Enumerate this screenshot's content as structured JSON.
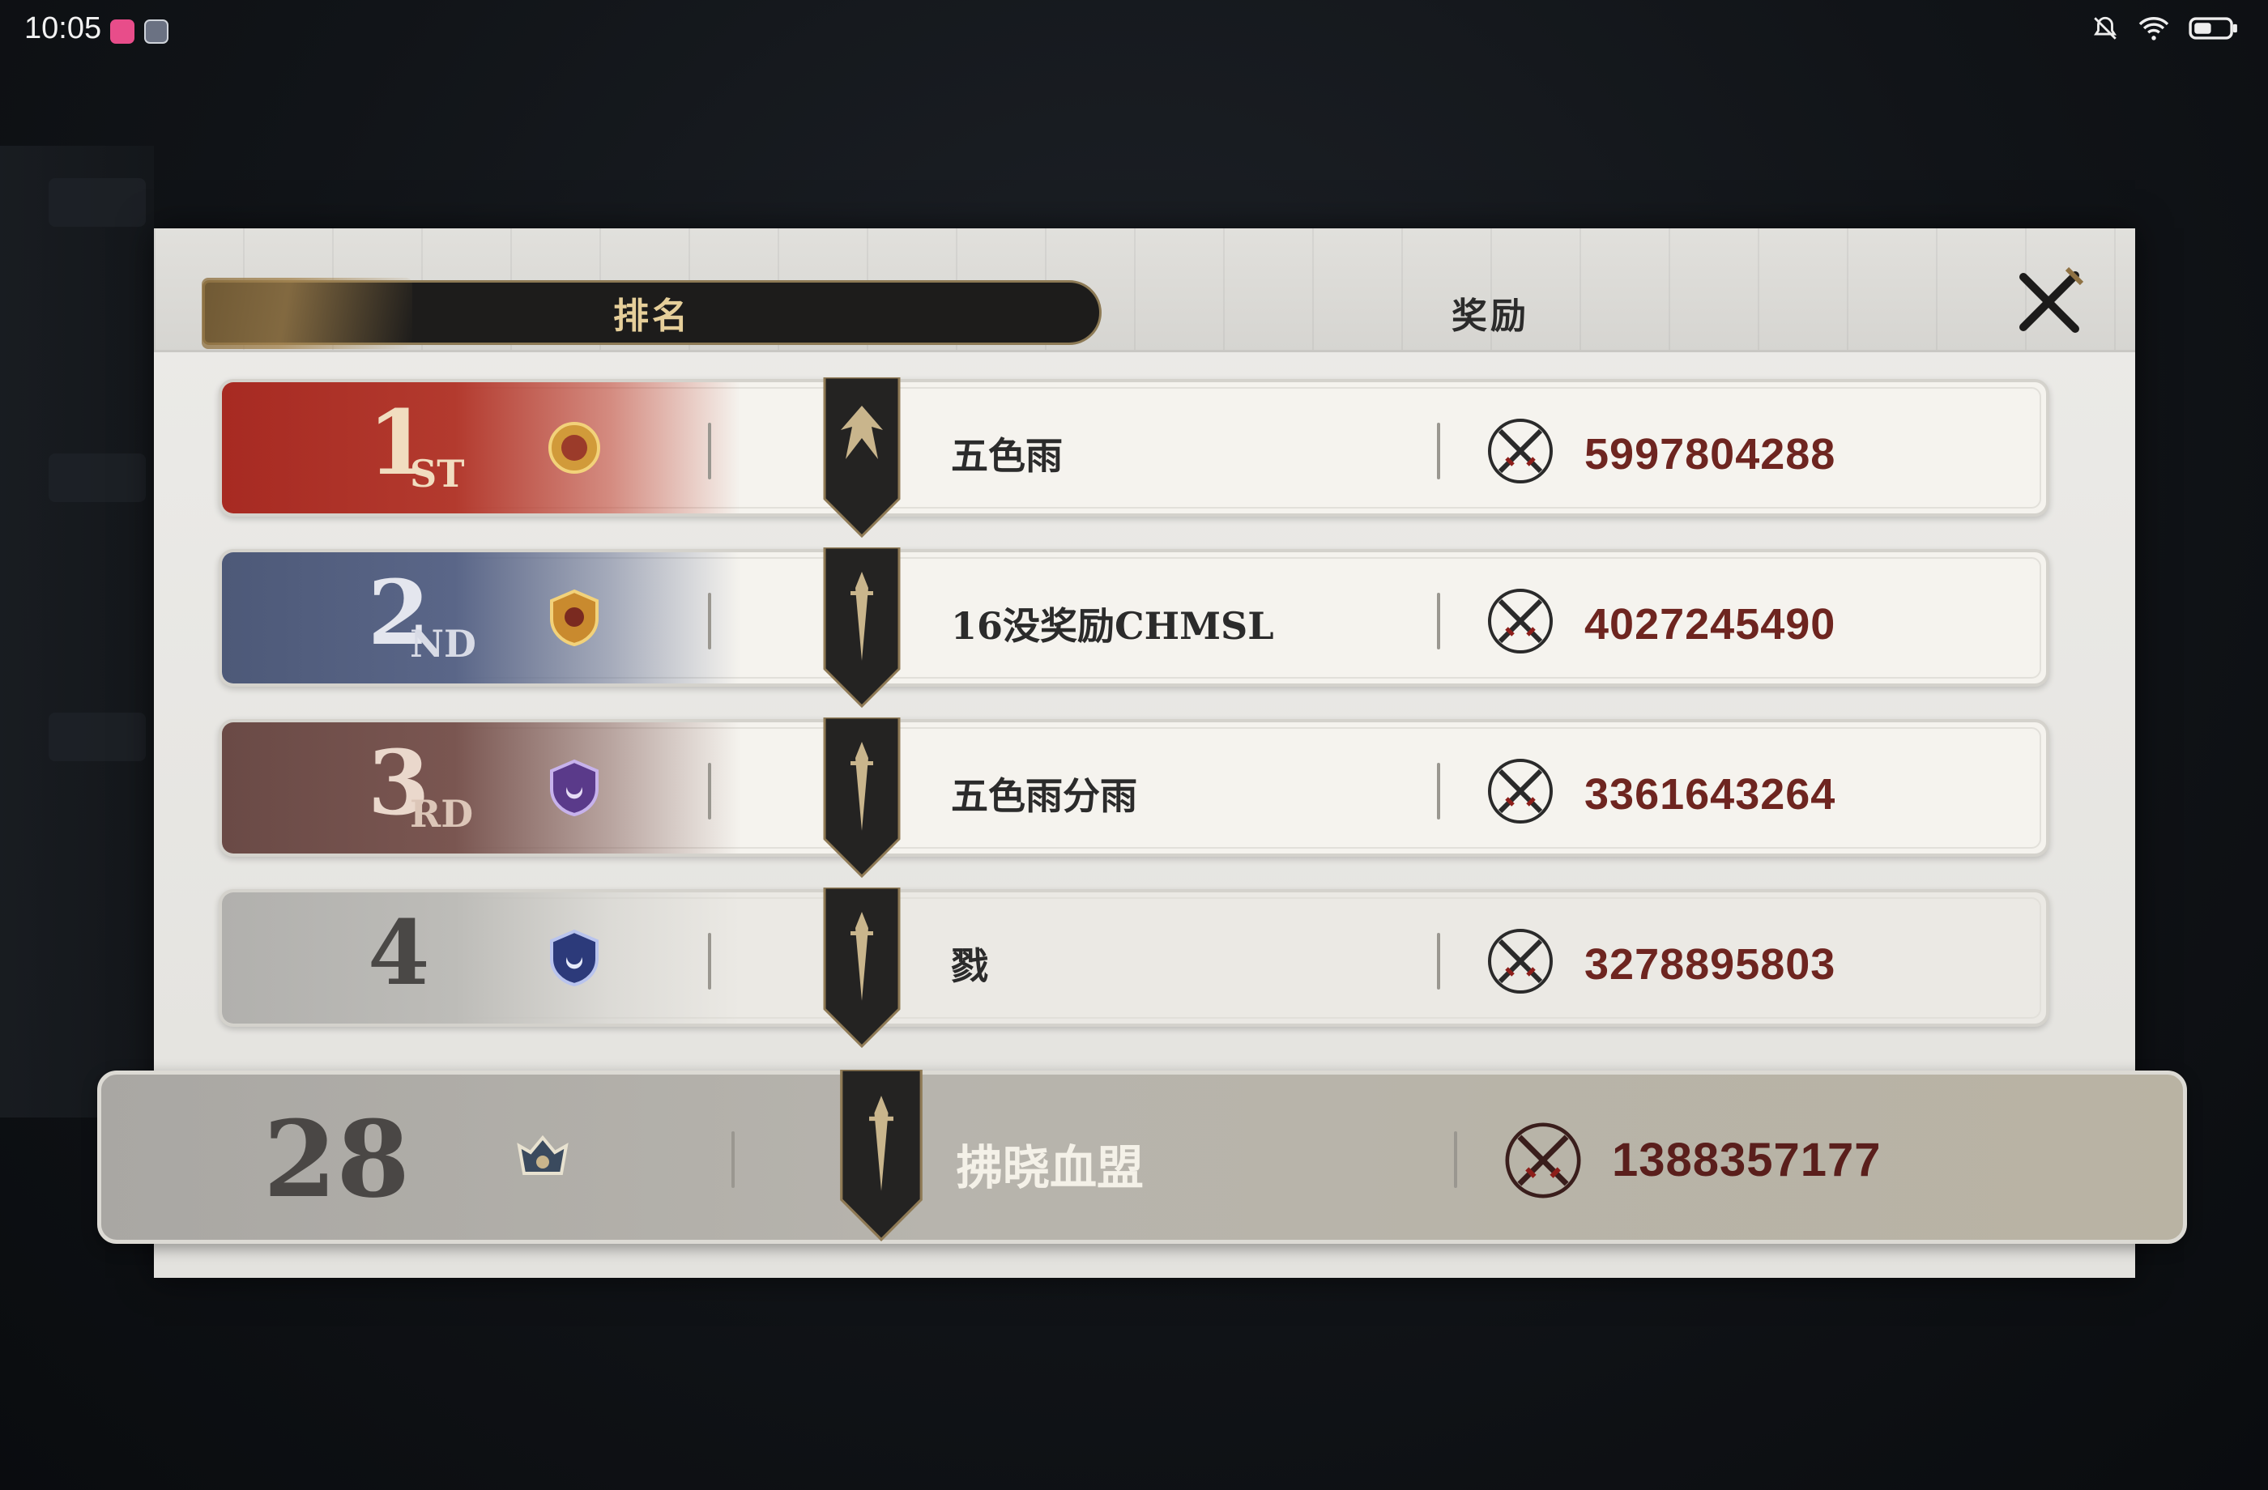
{
  "status_bar": {
    "time": "10:05"
  },
  "panel": {
    "tabs": {
      "rank": "排名",
      "reward": "奖励"
    }
  },
  "rows": [
    {
      "rank": "1",
      "suffix": "ST",
      "guild": "五色雨",
      "score": "5997804288"
    },
    {
      "rank": "2",
      "suffix": "ND",
      "guild": "16没奖励CHMSL",
      "score": "4027245490"
    },
    {
      "rank": "3",
      "suffix": "RD",
      "guild": "五色雨分雨",
      "score": "3361643264"
    },
    {
      "rank": "4",
      "suffix": "",
      "guild": "戮",
      "score": "3278895803"
    }
  ],
  "own": {
    "rank": "28",
    "guild": "拂晓血盟",
    "score": "1388357177"
  },
  "colors": {
    "first": "#a72a22",
    "second": "#4d5978",
    "third": "#6a4a46",
    "fourth": "#b1b0ad",
    "reward_text": "#6e2520",
    "tab_gold": "#e6cf9a"
  }
}
